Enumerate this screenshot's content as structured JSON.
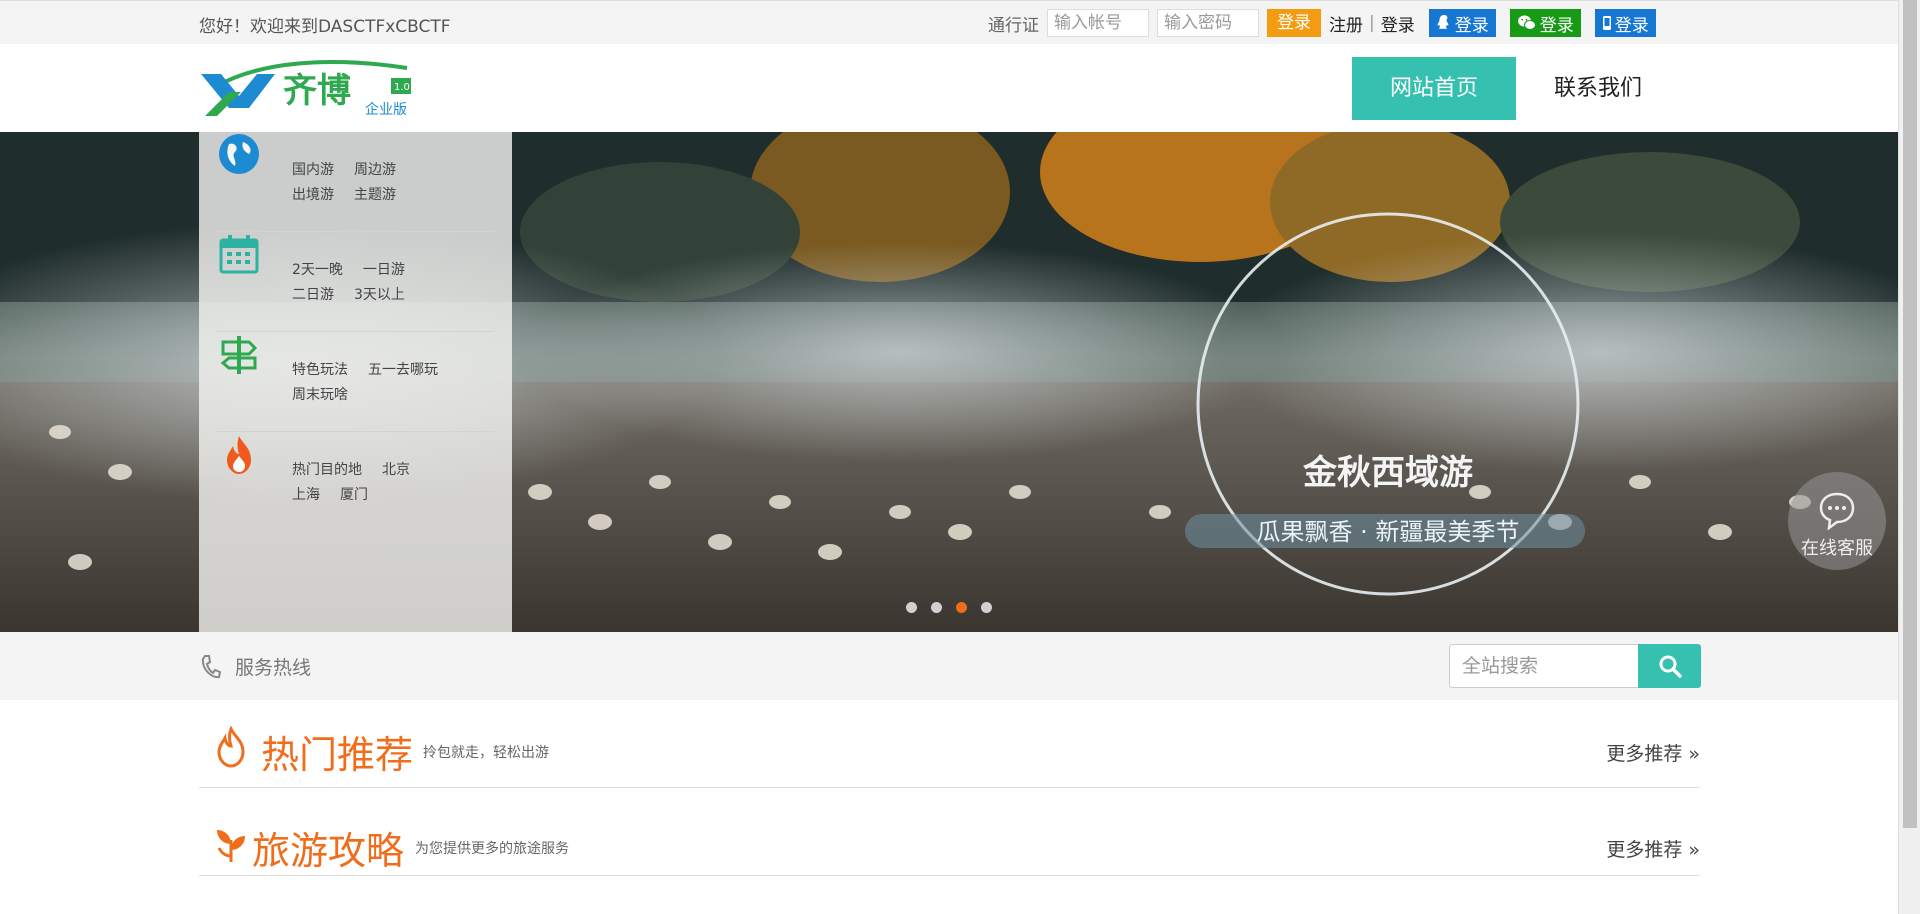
{
  "topbar": {
    "welcome": "您好！欢迎来到DASCTFxCBCTF",
    "passport_label": "通行证",
    "account_placeholder": "输入帐号",
    "password_placeholder": "输入密码",
    "login_button": "登录",
    "register_link": "注册",
    "separator": "|",
    "login_link": "登录",
    "qq_login": "登录",
    "wechat_login": "登录",
    "mobile_login": "登录"
  },
  "header": {
    "logo_text": "齐博",
    "logo_subtext": "企业版",
    "logo_version": "1.0",
    "nav": [
      {
        "label": "网站首页",
        "active": true
      },
      {
        "label": "联系我们",
        "active": false
      }
    ]
  },
  "banner": {
    "sidebar_groups": [
      {
        "icon": "globe-icon",
        "links": [
          "国内游",
          "周边游",
          "出境游",
          "主题游"
        ]
      },
      {
        "icon": "calendar-icon",
        "links": [
          "2天一晚",
          "一日游",
          "二日游",
          "3天以上"
        ]
      },
      {
        "icon": "signpost-icon",
        "links": [
          "特色玩法",
          "五一去哪玩",
          "周末玩啥"
        ]
      },
      {
        "icon": "fire-icon",
        "links": [
          "热门目的地",
          "北京",
          "上海",
          "厦门"
        ]
      }
    ],
    "slide_texts": [
      "金秋西域游",
      "瓜果飘香 · 新疆最美季节"
    ],
    "slide_count": 4,
    "active_slide": 3
  },
  "servicebar": {
    "hotline_label": "服务热线",
    "search_placeholder": "全站搜索"
  },
  "sections": [
    {
      "title": "热门推荐",
      "subtitle": "拎包就走，轻松出游",
      "more": "更多推荐 »"
    },
    {
      "title": "旅游攻略",
      "subtitle": "为您提供更多的旅途服务",
      "more": "更多推荐 »"
    }
  ],
  "chat": {
    "label": "在线客服"
  },
  "colors": {
    "accent": "#35c0b0",
    "orange": "#f06d1c",
    "login_orange": "#f39c12",
    "qq_blue": "#1677d2",
    "wechat_green": "#179b16"
  }
}
